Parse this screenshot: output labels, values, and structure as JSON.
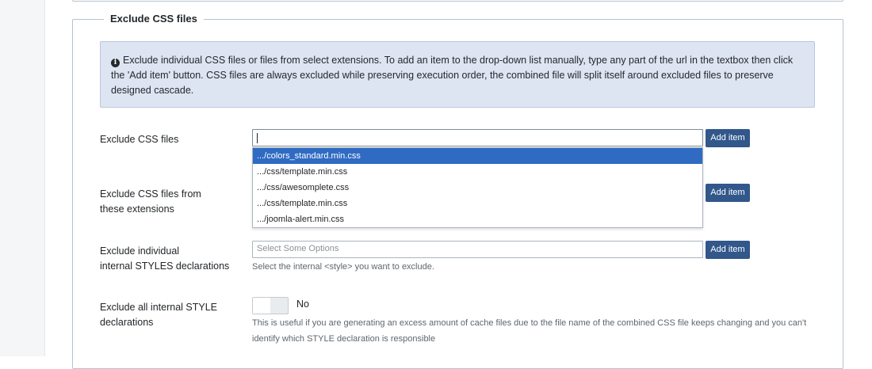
{
  "section": {
    "legend": "Exclude CSS files",
    "info_text": "Exclude individual CSS files or files from select extensions. To add an item to the drop-down list manually, type any part of the url in the textbox then click the 'Add item' button. CSS files are always excluded while preserving execution order, the combined file will split itself around excluded files to preserve designed cascade."
  },
  "fields": {
    "exclude_css": {
      "label": "Exclude CSS files",
      "input_value": "",
      "button": "Add item",
      "dropdown_items": [
        ".../colors_standard.min.css",
        ".../css/template.min.css",
        ".../css/awesomplete.css",
        ".../css/template.min.css",
        ".../joomla-alert.min.css"
      ],
      "selected_index": 0
    },
    "exclude_css_ext": {
      "label_line1": "Exclude CSS files from",
      "label_line2": "these extensions",
      "button": "Add item"
    },
    "exclude_styles": {
      "label_line1": "Exclude individual",
      "label_line2": "internal STYLES declarations",
      "placeholder": "Select Some Options",
      "button": "Add item",
      "help": "Select the internal <style> you want to exclude."
    },
    "exclude_all_styles": {
      "label_line1": "Exclude all internal STYLE",
      "label_line2": "declarations",
      "toggle_value": "No",
      "help_line1": "This is useful if you are generating an excess amount of cache files due to the file name of the combined CSS file keeps changing and you can't",
      "help_line2": "identify which STYLE declaration is responsible"
    }
  },
  "colors": {
    "primary_button": "#31578b",
    "selected_item": "#2f6bc3",
    "info_background": "#dde5f2"
  }
}
